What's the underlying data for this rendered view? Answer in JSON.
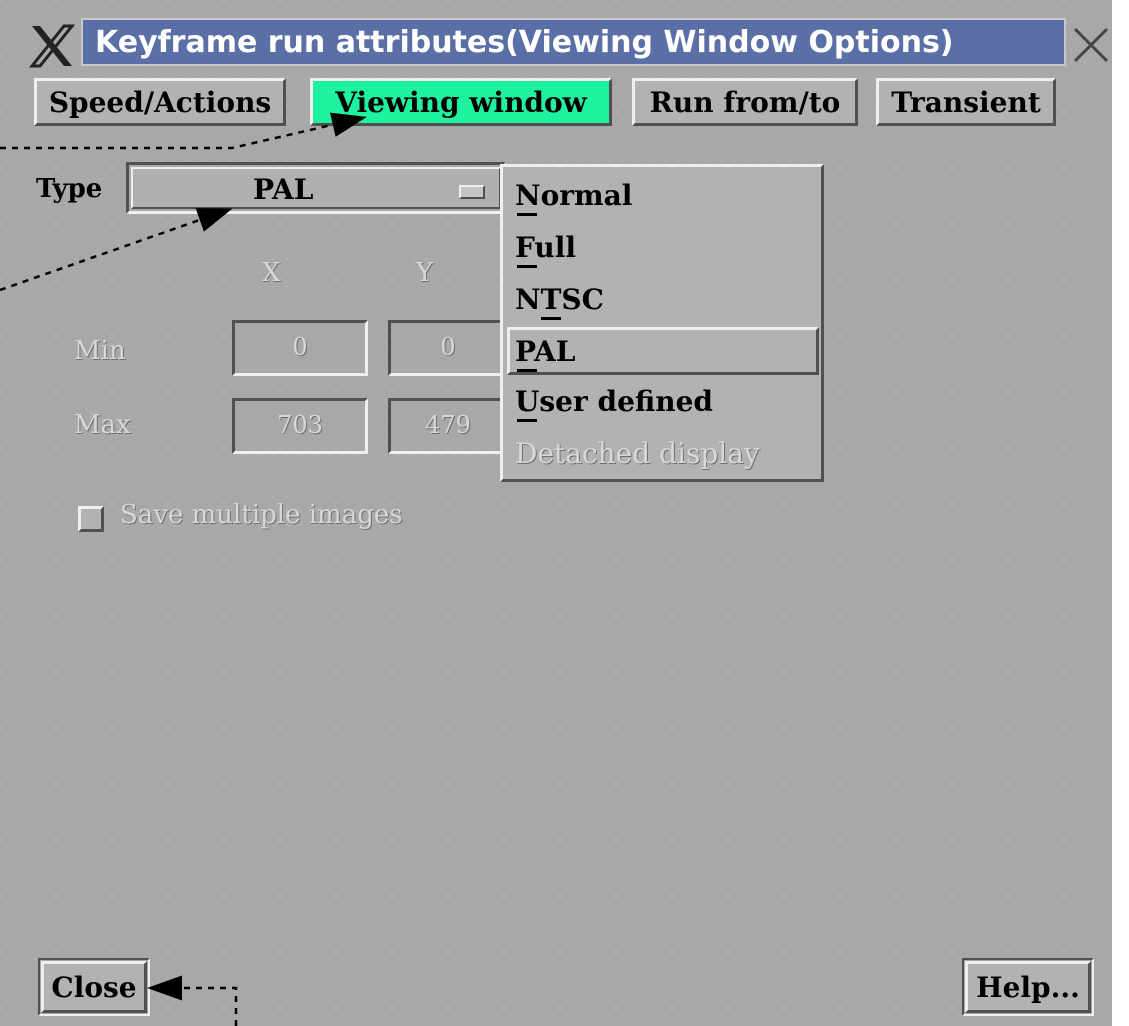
{
  "window": {
    "title": "Keyframe run attributes(Viewing Window Options)"
  },
  "tabs": [
    {
      "label": "Speed/Actions",
      "active": false
    },
    {
      "label": "Viewing window",
      "active": true
    },
    {
      "label": "Run from/to",
      "active": false
    },
    {
      "label": "Transient",
      "active": false
    }
  ],
  "form": {
    "type_label": "Type",
    "type_value": "PAL",
    "col_x": "X",
    "col_y": "Y",
    "min_label": "Min",
    "max_label": "Max",
    "min_x": "0",
    "min_y": "0",
    "max_x": "703",
    "max_y": "479",
    "save_multiple_label": "Save multiple images",
    "save_multiple_checked": false
  },
  "type_menu": {
    "items": [
      {
        "label": "Normal",
        "enabled": true
      },
      {
        "label": "Full",
        "enabled": true
      },
      {
        "label": "NTSC",
        "enabled": true
      },
      {
        "label": "PAL",
        "enabled": true,
        "selected": true
      },
      {
        "label": "User defined",
        "enabled": true
      },
      {
        "label": "Detached display",
        "enabled": false
      }
    ]
  },
  "buttons": {
    "close": "Close",
    "help": "Help..."
  },
  "colors": {
    "active_tab": "#1ef29e",
    "title_bar": "#5a6fa6",
    "window_bg": "#a8a8a8"
  },
  "icons": {
    "window_menu": "x-logo-icon",
    "window_close": "close-icon"
  }
}
